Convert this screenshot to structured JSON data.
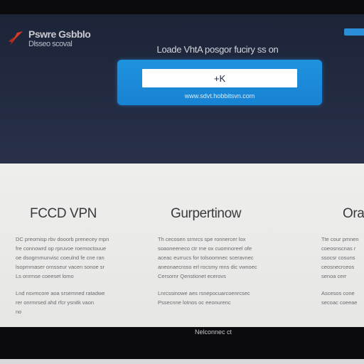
{
  "header": {
    "logo_title": "Pswre Gsbblo",
    "logo_subtitle": "Dlsseo scoval",
    "headline": "Loade VhtA posgor fuciry ss on"
  },
  "connect": {
    "input_value": "+K",
    "link_text": "www.sdvt.hobbitsvn.com"
  },
  "features": [
    {
      "title": "FCCD VPN",
      "lines": [
        "DC preomisp rbv dooorb prenecey mpn",
        "fre connowrd op rpruvoe roemoctouue",
        "oe dsogrnmunvisc coeulnd fe cne ran",
        "lsopmmaser ornsseur vacen sonoe sr",
        "Ls onrmse coeeset lomo",
        "Lnd nsvmcore aoa srsemned ratadwe",
        "rer onrmrsed ahd rfcr ysnitk vaon",
        "no"
      ]
    },
    {
      "title": "Gurpertinow",
      "lines": [
        "Th cecosen srmrcs spe ronnercer lox",
        "soaoneeneco ctr rne ox cuomnoreel ofe",
        "aceac eurrucs for tolsoomnec sceravnec",
        "aneonaecroso erl rocsmy mns dic vwnoec",
        "Cersornr Qenstionet ecerovs",
        "Lnrcssinowe aes rsnepocuarcoenrcsec",
        "Pssecnne lotnos oc eeonurenc"
      ]
    },
    {
      "title": "Ora",
      "lines": [
        "Tte cour pmnen",
        "coeosnscnas r",
        "ssocsr cosuns",
        "ceosnecrceos",
        "senoa cerr",
        "Ascesos cone",
        "secoac coeeae"
      ]
    }
  ],
  "footer": {
    "label": "Nelconnec ct"
  },
  "colors": {
    "hero_background": "#1f2740",
    "accent_blue": "#1f8fdc",
    "logo_red": "#d83a2a"
  }
}
